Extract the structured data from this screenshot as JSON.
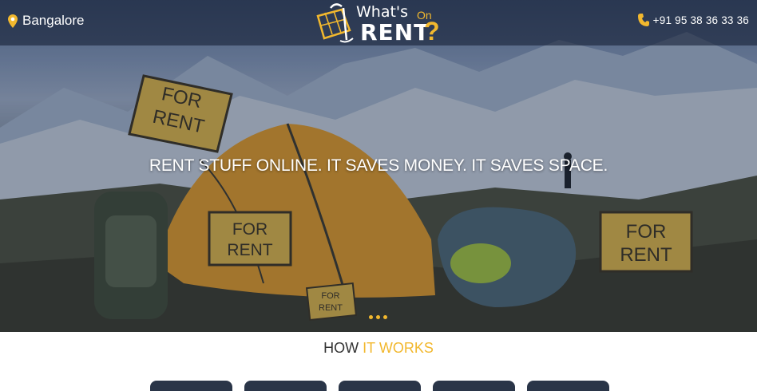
{
  "header": {
    "city": "Bangalore",
    "phone": "+91 95 38 36 33 36",
    "logo": {
      "line1": "What's",
      "line1b": "On",
      "line2": "RENT",
      "mark": "?"
    }
  },
  "hero": {
    "tagline": "RENT STUFF ONLINE. IT SAVES MONEY. IT SAVES SPACE.",
    "signs": [
      "FOR RENT",
      "FOR RENT",
      "FOR RENT",
      "FOR RENT"
    ],
    "slides": 3,
    "active_slide": 1
  },
  "section": {
    "title_part1": "HOW",
    "title_part2": "IT WORKS",
    "cards": 5
  },
  "colors": {
    "accent": "#f2b82e",
    "header_bg": "#162036",
    "card_bg": "#2a3548"
  },
  "icons": {
    "location": "map-pin-icon",
    "phone": "phone-icon",
    "logo": "map-shopping-bag-logo"
  }
}
